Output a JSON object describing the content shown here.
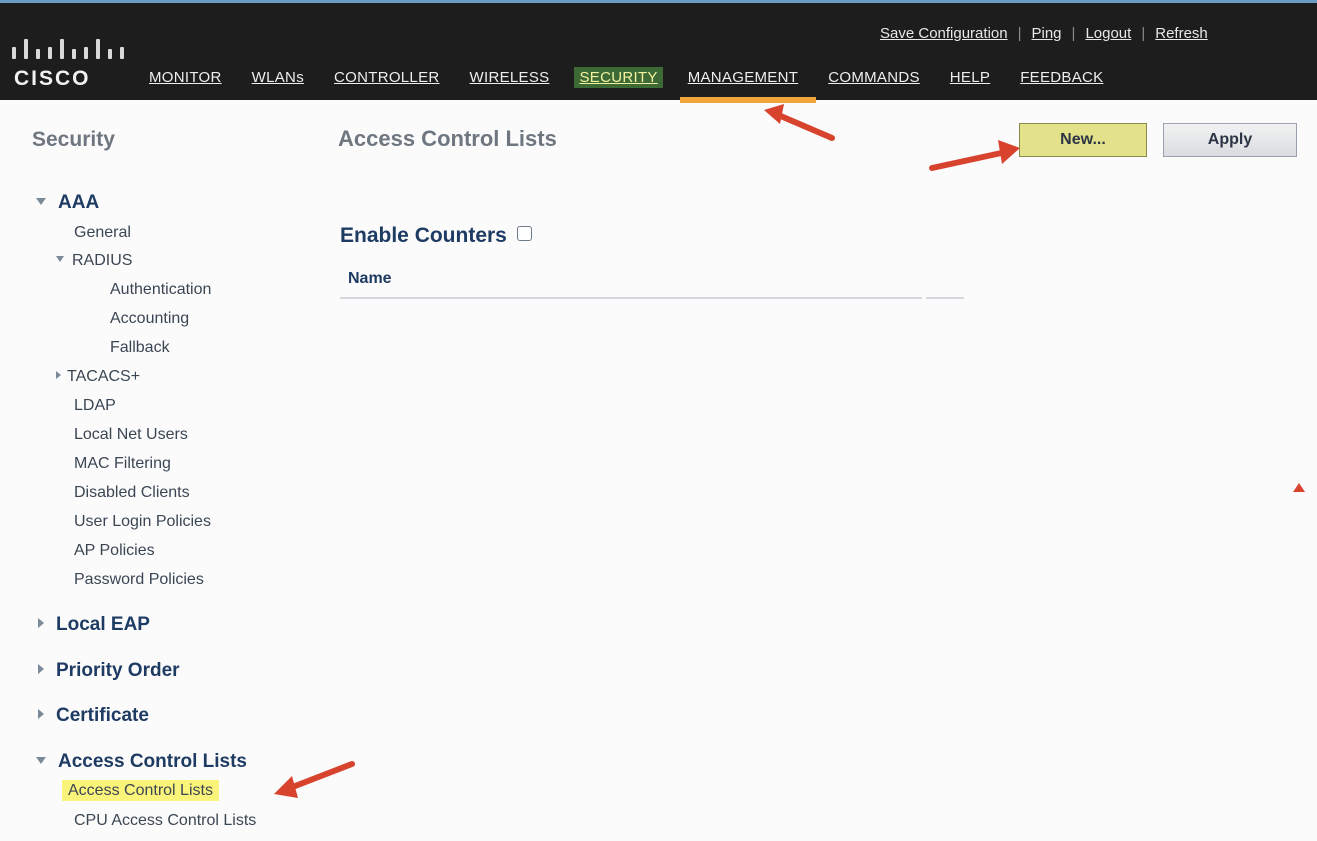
{
  "header": {
    "brand": "CISCO",
    "utility_links": [
      "Save Configuration",
      "Ping",
      "Logout",
      "Refresh"
    ],
    "nav": [
      {
        "label": "MONITOR"
      },
      {
        "label": "WLANs"
      },
      {
        "label": "CONTROLLER"
      },
      {
        "label": "WIRELESS"
      },
      {
        "label": "SECURITY",
        "active": true
      },
      {
        "label": "MANAGEMENT"
      },
      {
        "label": "COMMANDS"
      },
      {
        "label": "HELP"
      },
      {
        "label": "FEEDBACK"
      }
    ]
  },
  "sidebar": {
    "title": "Security",
    "aaa": {
      "label": "AAA",
      "general": "General",
      "radius": {
        "label": "RADIUS",
        "items": [
          "Authentication",
          "Accounting",
          "Fallback"
        ]
      },
      "tacacs": "TACACS+",
      "items": [
        "LDAP",
        "Local Net Users",
        "MAC Filtering",
        "Disabled Clients",
        "User Login Policies",
        "AP Policies",
        "Password Policies"
      ]
    },
    "local_eap": "Local EAP",
    "priority_order": "Priority Order",
    "certificate": "Certificate",
    "acl": {
      "label": "Access Control Lists",
      "items": [
        "Access Control Lists",
        "CPU Access Control Lists"
      ]
    }
  },
  "main": {
    "title": "Access Control Lists",
    "new_button": "New...",
    "apply_button": "Apply",
    "enable_counters": "Enable Counters",
    "column_name": "Name"
  },
  "colors": {
    "header_bg": "#1d1d1d",
    "active_tab_bg": "#3d6a34",
    "active_tab_underline": "#f0a63a",
    "highlight": "#fbf47a",
    "new_button_bg": "#e3e28a",
    "annotation_arrow": "#d8432e"
  }
}
